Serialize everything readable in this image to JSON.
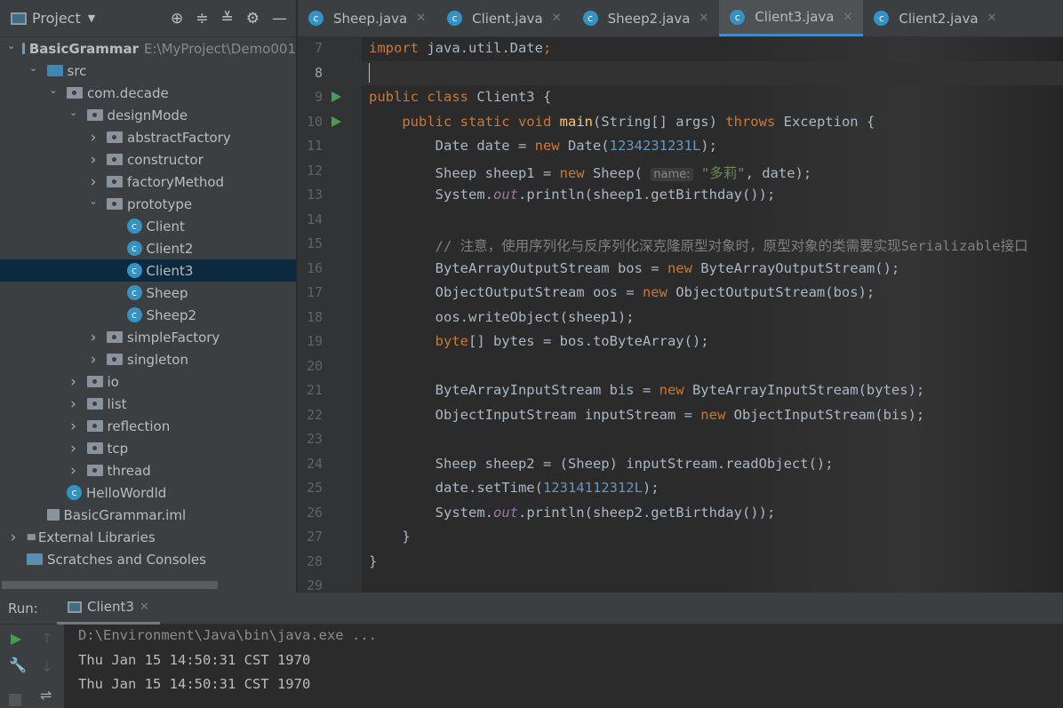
{
  "sidebar": {
    "title": "Project",
    "tree": [
      {
        "label": "BasicGrammar",
        "path": "E:\\MyProject\\Demo001",
        "depth": 0,
        "icon": "module",
        "open": true,
        "bold": true
      },
      {
        "label": "src",
        "depth": 1,
        "icon": "src",
        "open": true
      },
      {
        "label": "com.decade",
        "depth": 2,
        "icon": "package",
        "open": true
      },
      {
        "label": "designMode",
        "depth": 3,
        "icon": "package",
        "open": true
      },
      {
        "label": "abstractFactory",
        "depth": 4,
        "icon": "package",
        "open": false
      },
      {
        "label": "constructor",
        "depth": 4,
        "icon": "package",
        "open": false
      },
      {
        "label": "factoryMethod",
        "depth": 4,
        "icon": "package",
        "open": false
      },
      {
        "label": "prototype",
        "depth": 4,
        "icon": "package",
        "open": true
      },
      {
        "label": "Client",
        "depth": 5,
        "icon": "class"
      },
      {
        "label": "Client2",
        "depth": 5,
        "icon": "class"
      },
      {
        "label": "Client3",
        "depth": 5,
        "icon": "class",
        "selected": true
      },
      {
        "label": "Sheep",
        "depth": 5,
        "icon": "class"
      },
      {
        "label": "Sheep2",
        "depth": 5,
        "icon": "class"
      },
      {
        "label": "simpleFactory",
        "depth": 4,
        "icon": "package",
        "open": false
      },
      {
        "label": "singleton",
        "depth": 4,
        "icon": "package",
        "open": false
      },
      {
        "label": "io",
        "depth": 3,
        "icon": "package",
        "open": false
      },
      {
        "label": "list",
        "depth": 3,
        "icon": "package",
        "open": false
      },
      {
        "label": "reflection",
        "depth": 3,
        "icon": "package",
        "open": false
      },
      {
        "label": "tcp",
        "depth": 3,
        "icon": "package",
        "open": false
      },
      {
        "label": "thread",
        "depth": 3,
        "icon": "package",
        "open": false
      },
      {
        "label": "HelloWordld",
        "depth": 2,
        "icon": "class"
      },
      {
        "label": "BasicGrammar.iml",
        "depth": 1,
        "icon": "file"
      },
      {
        "label": "External Libraries",
        "depth": 0,
        "icon": "library",
        "open": false
      },
      {
        "label": "Scratches and Consoles",
        "depth": 0,
        "icon": "scratch"
      }
    ]
  },
  "tabs": [
    {
      "label": "Sheep.java"
    },
    {
      "label": "Client.java"
    },
    {
      "label": "Sheep2.java"
    },
    {
      "label": "Client3.java",
      "active": true
    },
    {
      "label": "Client2.java"
    }
  ],
  "editor": {
    "lines": [
      {
        "n": "7",
        "t": [
          [
            "import",
            "kw"
          ],
          [
            " java.util.Date",
            ""
          ],
          [
            ";",
            "kw"
          ]
        ]
      },
      {
        "n": "8",
        "t": [],
        "current": true
      },
      {
        "n": "9",
        "run": true,
        "t": [
          [
            "public class",
            "kw"
          ],
          [
            " Client3 {",
            ""
          ]
        ]
      },
      {
        "n": "10",
        "run": true,
        "t": [
          [
            "    public static void",
            "kw"
          ],
          [
            " ",
            ""
          ],
          [
            "main",
            "fn"
          ],
          [
            "(String[] args) ",
            ""
          ],
          [
            "throws",
            "kw"
          ],
          [
            " Exception {",
            ""
          ]
        ]
      },
      {
        "n": "11",
        "t": [
          [
            "        Date date = ",
            ""
          ],
          [
            "new",
            "kw"
          ],
          [
            " Date(",
            ""
          ],
          [
            "1234231231L",
            "num"
          ],
          [
            ");",
            ""
          ]
        ]
      },
      {
        "n": "12",
        "t": [
          [
            "        Sheep sheep1 = ",
            ""
          ],
          [
            "new",
            "kw"
          ],
          [
            " Sheep( ",
            ""
          ],
          [
            "name:",
            "hint"
          ],
          [
            " ",
            ""
          ],
          [
            "\"多莉\"",
            "str"
          ],
          [
            ", date);",
            ""
          ]
        ]
      },
      {
        "n": "13",
        "t": [
          [
            "        System.",
            ""
          ],
          [
            "out",
            "st"
          ],
          [
            ".println(sheep1.getBirthday());",
            ""
          ]
        ]
      },
      {
        "n": "14",
        "t": []
      },
      {
        "n": "15",
        "t": [
          [
            "        // 注意，使用序列化与反序列化深克隆原型对象时，原型对象的类需要实现Serializable接口",
            "cm"
          ]
        ]
      },
      {
        "n": "16",
        "t": [
          [
            "        ByteArrayOutputStream bos = ",
            ""
          ],
          [
            "new",
            "kw"
          ],
          [
            " ByteArrayOutputStream();",
            ""
          ]
        ]
      },
      {
        "n": "17",
        "t": [
          [
            "        ObjectOutputStream oos = ",
            ""
          ],
          [
            "new",
            "kw"
          ],
          [
            " ObjectOutputStream(bos);",
            ""
          ]
        ]
      },
      {
        "n": "18",
        "t": [
          [
            "        oos.writeObject(sheep1);",
            ""
          ]
        ]
      },
      {
        "n": "19",
        "t": [
          [
            "        ",
            ""
          ],
          [
            "byte",
            "kw"
          ],
          [
            "[] bytes = bos.toByteArray();",
            ""
          ]
        ]
      },
      {
        "n": "20",
        "t": []
      },
      {
        "n": "21",
        "t": [
          [
            "        ByteArrayInputStream bis = ",
            ""
          ],
          [
            "new",
            "kw"
          ],
          [
            " ByteArrayInputStream(bytes);",
            ""
          ]
        ]
      },
      {
        "n": "22",
        "t": [
          [
            "        ObjectInputStream inputStream = ",
            ""
          ],
          [
            "new",
            "kw"
          ],
          [
            " ObjectInputStream(bis);",
            ""
          ]
        ]
      },
      {
        "n": "23",
        "t": []
      },
      {
        "n": "24",
        "t": [
          [
            "        Sheep sheep2 = (Sheep) inputStream.readObject();",
            ""
          ]
        ]
      },
      {
        "n": "25",
        "t": [
          [
            "        date.setTime(",
            ""
          ],
          [
            "12314112312L",
            "num"
          ],
          [
            ");",
            ""
          ]
        ]
      },
      {
        "n": "26",
        "t": [
          [
            "        System.",
            ""
          ],
          [
            "out",
            "st"
          ],
          [
            ".println(sheep2.getBirthday());",
            ""
          ]
        ]
      },
      {
        "n": "27",
        "t": [
          [
            "    }",
            ""
          ]
        ]
      },
      {
        "n": "28",
        "t": [
          [
            "}",
            ""
          ]
        ]
      },
      {
        "n": "29",
        "t": []
      }
    ]
  },
  "run": {
    "label": "Run:",
    "tab": "Client3",
    "output": [
      "D:\\Environment\\Java\\bin\\java.exe ...",
      "Thu Jan 15 14:50:31 CST 1970",
      "Thu Jan 15 14:50:31 CST 1970"
    ]
  }
}
